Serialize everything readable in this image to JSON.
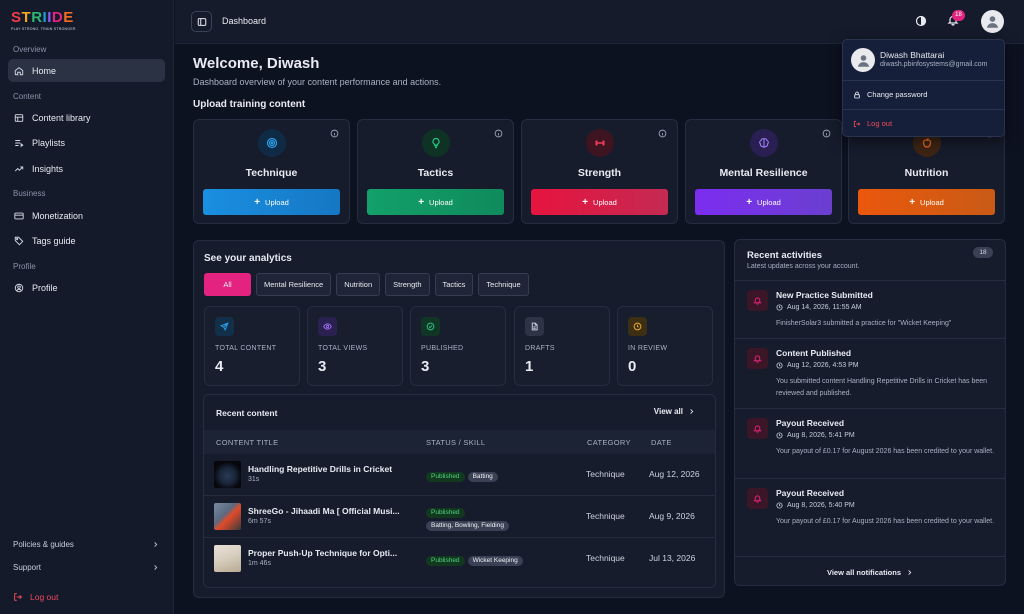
{
  "brand": {
    "name_letters": [
      "S",
      "T",
      "R",
      "I",
      "I",
      "D",
      "E"
    ],
    "name_colors": [
      "#ef3b4c",
      "#f5a623",
      "#2bb673",
      "#1a9fe0",
      "#8b5cf6",
      "#e3237f",
      "#f26b21"
    ],
    "tagline": "PLAY STRONG. TRAIN STRONGER"
  },
  "sidebar": {
    "sections": {
      "overview": "Overview",
      "content": "Content",
      "business": "Business",
      "profile": "Profile"
    },
    "items": {
      "home": "Home",
      "content_library": "Content library",
      "playlists": "Playlists",
      "insights": "Insights",
      "monetization": "Monetization",
      "tags_guide": "Tags guide",
      "profile": "Profile"
    },
    "footer": {
      "policies": "Policies & guides",
      "support": "Support",
      "logout": "Log out"
    }
  },
  "topbar": {
    "breadcrumb": "Dashboard",
    "notification_count": "18"
  },
  "header": {
    "welcome": "Welcome, Diwash",
    "subtitle": "Dashboard overview of your content performance and actions.",
    "upload_heading": "Upload training content"
  },
  "upload_cards": [
    {
      "title": "Technique",
      "button": "Upload",
      "color": "#1f8fe0",
      "icon": "target-icon"
    },
    {
      "title": "Tactics",
      "button": "Upload",
      "color": "#14a06b",
      "icon": "lightbulb-icon"
    },
    {
      "title": "Strength",
      "button": "Upload",
      "color": "#e0204b",
      "icon": "dumbbell-icon"
    },
    {
      "title": "Mental Resilience",
      "button": "Upload",
      "color": "#7c3aed",
      "icon": "brain-icon"
    },
    {
      "title": "Nutrition",
      "button": "Upload",
      "color": "#ea580c",
      "icon": "apple-icon"
    }
  ],
  "analytics": {
    "title": "See your analytics",
    "filters": [
      "All",
      "Mental Resilience",
      "Nutrition",
      "Strength",
      "Tactics",
      "Technique"
    ],
    "stats": [
      {
        "label": "TOTAL CONTENT",
        "value": "4",
        "icon": "send-icon",
        "color": "#2a9fe8"
      },
      {
        "label": "TOTAL VIEWS",
        "value": "3",
        "icon": "eye-icon",
        "color": "#9b6cf0"
      },
      {
        "label": "PUBLISHED",
        "value": "3",
        "icon": "check-circle-icon",
        "color": "#27c07a"
      },
      {
        "label": "DRAFTS",
        "value": "1",
        "icon": "file-icon",
        "color": "#c9cedb"
      },
      {
        "label": "IN REVIEW",
        "value": "0",
        "icon": "clock-icon",
        "color": "#f0a72a"
      }
    ]
  },
  "recent_content": {
    "title": "Recent content",
    "view_all": "View all",
    "columns": [
      "CONTENT TITLE",
      "STATUS / SKILL",
      "CATEGORY",
      "DATE"
    ],
    "rows": [
      {
        "title": "Handling Repetitive Drills in Cricket",
        "duration": "31s",
        "status": "Published",
        "skills": "Batting",
        "category": "Technique",
        "date": "Aug 12, 2026"
      },
      {
        "title": "ShreeGo - Jihaadi Ma [ Official Musi...",
        "duration": "6m 57s",
        "status": "Published",
        "skills": "Batting, Bowling, Fielding",
        "category": "Technique",
        "date": "Aug 9, 2026"
      },
      {
        "title": "Proper Push-Up Technique for Opti...",
        "duration": "1m 46s",
        "status": "Published",
        "skills": "Wicket Keeping",
        "category": "Technique",
        "date": "Jul 13, 2026"
      }
    ]
  },
  "activities": {
    "title": "Recent activities",
    "subtitle": "Latest updates across your account.",
    "count": "18",
    "items": [
      {
        "title": "New Practice Submitted",
        "time": "Aug 14, 2026, 11:55 AM",
        "text": "FinisherSolar3 submitted a practice for \"Wicket Keeping\""
      },
      {
        "title": "Content Published",
        "time": "Aug 12, 2026, 4:53 PM",
        "text": "You submitted content Handling Repetitive Drills in Cricket has been reviewed and published."
      },
      {
        "title": "Payout Received",
        "time": "Aug 8, 2026, 5:41 PM",
        "text": "Your payout of £0.17 for August 2026 has been credited to your wallet."
      },
      {
        "title": "Payout Received",
        "time": "Aug 8, 2026, 5:40 PM",
        "text": "Your payout of £0.17 for August 2026 has been credited to your wallet."
      }
    ],
    "view_all": "View all notifications"
  },
  "user_menu": {
    "name": "Diwash Bhattarai",
    "email": "diwash.pbinfosystems@gmail.com",
    "change_password": "Change password",
    "logout": "Log out"
  }
}
